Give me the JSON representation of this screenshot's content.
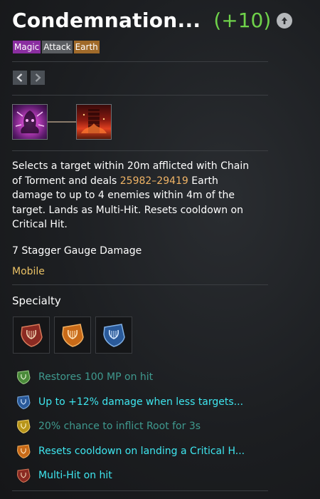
{
  "skill": {
    "name": "Condemnation...",
    "level": "(+10)",
    "tags": [
      "Magic",
      "Attack",
      "Earth"
    ]
  },
  "description": {
    "part1": "Selects a target within 20m afflicted with Chain of Torment and deals ",
    "damage": "25982–29419",
    "part2": " Earth damage to up to 4 enemies within 4m of the target. Lands as Multi-Hit. Resets cooldown on Critical Hit."
  },
  "stagger": "7 Stagger Gauge Damage",
  "mobility": "Mobile",
  "specialty": {
    "title": "Specialty",
    "icons": [
      "red-lyre-shield-icon",
      "orange-lyre-shield-icon",
      "blue-lyre-shield-icon"
    ]
  },
  "effects": [
    {
      "text": "Restores 100 MP on hit",
      "active": false,
      "icon": "green-shield-icon"
    },
    {
      "text": "Up to +12% damage when less targets...",
      "active": true,
      "icon": "blue-shield-icon"
    },
    {
      "text": "20% chance to inflict Root for 3s",
      "active": false,
      "icon": "yellow-shield-icon"
    },
    {
      "text": "Resets cooldown on landing a Critical H...",
      "active": true,
      "icon": "orange-shield-icon"
    },
    {
      "text": "Multi-Hit on hit",
      "active": true,
      "icon": "red-shield-icon"
    }
  ],
  "colors": {
    "level": "#6fd24a",
    "damage": "#f0b466",
    "mobility": "#e9c165",
    "effect_active": "#3ee6ef",
    "effect_inactive": "#3f9a8f",
    "tag_magic": "#8a2ea0",
    "tag_attack": "#5a5d61",
    "tag_earth": "#a06a2a"
  }
}
